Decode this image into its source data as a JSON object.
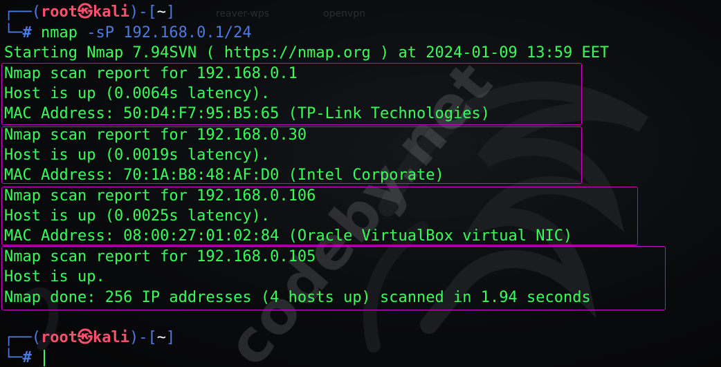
{
  "terminal": {
    "bg_tabs": [
      "reaver-wps",
      "openvpn"
    ],
    "watermark": "codeby.net",
    "prompt1": {
      "frame_open": "┌──(",
      "user": "root",
      "skull": "㉿",
      "host": "kali",
      "frame_mid": ")-[",
      "dir": "~",
      "frame_close": "]",
      "frame_bottom": "└─",
      "hash": "#",
      "command": "nmap",
      "args": " -sP 192.168.0.1/24"
    },
    "output": {
      "starting": "Starting Nmap 7.94SVN ( https://nmap.org ) at 2024-01-09 13:59 EET",
      "hosts": [
        {
          "report": "Nmap scan report for 192.168.0.1",
          "status": "Host is up (0.0064s latency).",
          "mac": "MAC Address: 50:D4:F7:95:B5:65 (TP-Link Technologies)"
        },
        {
          "report": "Nmap scan report for 192.168.0.30",
          "status": "Host is up (0.0019s latency).",
          "mac": "MAC Address: 70:1A:B8:48:AF:D0 (Intel Corporate)"
        },
        {
          "report": "Nmap scan report for 192.168.0.106",
          "status": "Host is up (0.0025s latency).",
          "mac": "MAC Address: 08:00:27:01:02:84 (Oracle VirtualBox virtual NIC)"
        },
        {
          "report": "Nmap scan report for 192.168.0.105",
          "status": "Host is up.",
          "done": "Nmap done: 256 IP addresses (4 hosts up) scanned in 1.94 seconds"
        }
      ]
    },
    "prompt2": {
      "frame_open": "┌──(",
      "user": "root",
      "skull": "㉿",
      "host": "kali",
      "frame_mid": ")-[",
      "dir": "~",
      "frame_close": "]",
      "frame_bottom": "└─",
      "hash": "#"
    },
    "colors": {
      "text": "#39ff5a",
      "frame": "#4c7be0",
      "user": "#ff4f6e",
      "highlight_box": "#d000d0",
      "background": "#0a0b0d"
    }
  }
}
